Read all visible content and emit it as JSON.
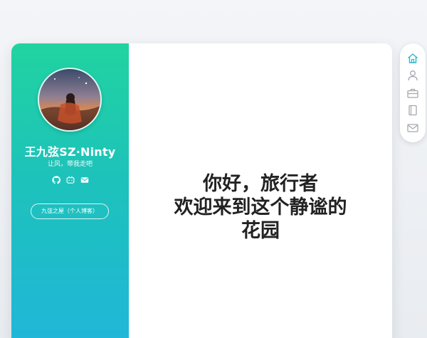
{
  "profile": {
    "name": "王九弦SZ·Ninty",
    "motto": "让风，带我走吧",
    "homepage_button": "九弦之屋（个人博客）",
    "socials": [
      {
        "icon": "github-icon"
      },
      {
        "icon": "bilibili-icon"
      },
      {
        "icon": "mail-icon"
      }
    ]
  },
  "main": {
    "greeting_lines": [
      "你好，旅行者",
      "欢迎来到这个静谧的",
      "花园"
    ]
  },
  "right_nav": {
    "items": [
      {
        "icon": "home-icon",
        "active": true
      },
      {
        "icon": "user-icon"
      },
      {
        "icon": "briefcase-icon"
      },
      {
        "icon": "book-icon"
      },
      {
        "icon": "mail-icon"
      }
    ]
  },
  "colors": {
    "sidebar_top": "#21d3a0",
    "sidebar_bottom": "#20b6da",
    "accent": "#29b6c8"
  }
}
